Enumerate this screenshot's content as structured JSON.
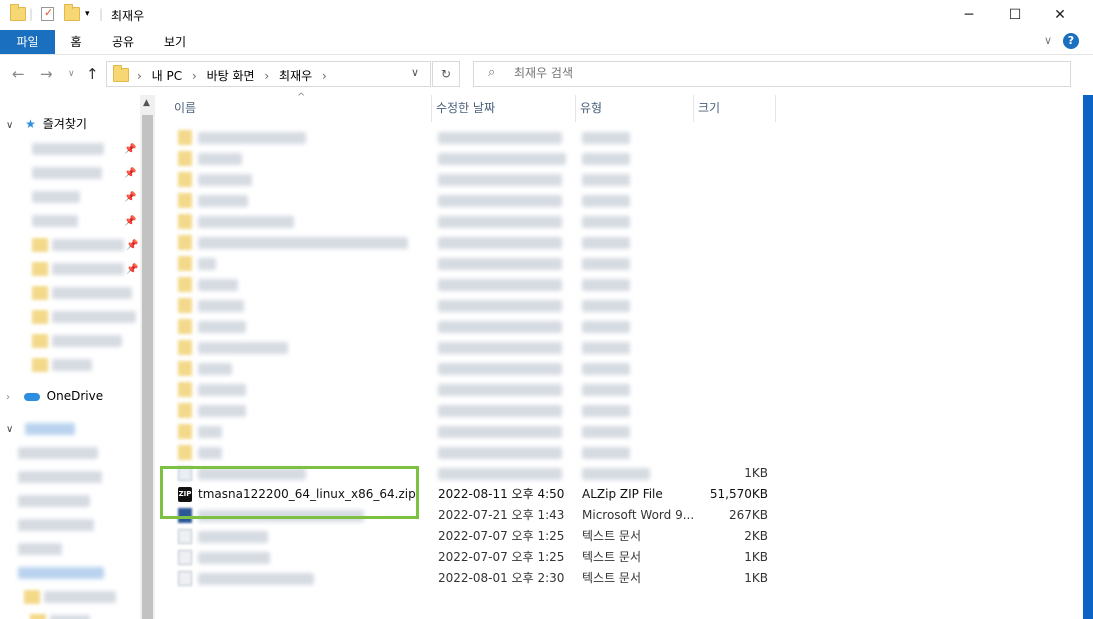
{
  "window": {
    "title": "최재우"
  },
  "ribbon": {
    "tabs": [
      "파일",
      "홈",
      "공유",
      "보기"
    ]
  },
  "address": {
    "crumbs": [
      "내 PC",
      "바탕 화면",
      "최재우"
    ],
    "search_placeholder": "최재우 검색"
  },
  "nav": {
    "quick_access": "즐겨찾기",
    "onedrive": "OneDrive"
  },
  "columns": {
    "name": "이름",
    "date": "수정한 날짜",
    "type": "유형",
    "size": "크기"
  },
  "files": [
    {
      "name": "",
      "date": "",
      "type": "",
      "size": "1KB"
    },
    {
      "name": "tmasna122200_64_linux_x86_64.zip",
      "date": "2022-08-11 오후 4:50",
      "type": "ALZip ZIP File",
      "size": "51,570KB"
    },
    {
      "name": "",
      "date": "2022-07-21 오후 1:43",
      "type": "Microsoft Word 9...",
      "size": "267KB"
    },
    {
      "name": "",
      "date": "2022-07-07 오후 1:25",
      "type": "텍스트 문서",
      "size": "2KB"
    },
    {
      "name": "",
      "date": "2022-07-07 오후 1:25",
      "type": "텍스트 문서",
      "size": "1KB"
    },
    {
      "name": "",
      "date": "2022-08-01 오후 2:30",
      "type": "텍스트 문서",
      "size": "1KB"
    }
  ],
  "icons": {
    "zip": "zip-file-icon",
    "folder": "folder-icon",
    "search": "search-icon",
    "help": "help-icon"
  }
}
